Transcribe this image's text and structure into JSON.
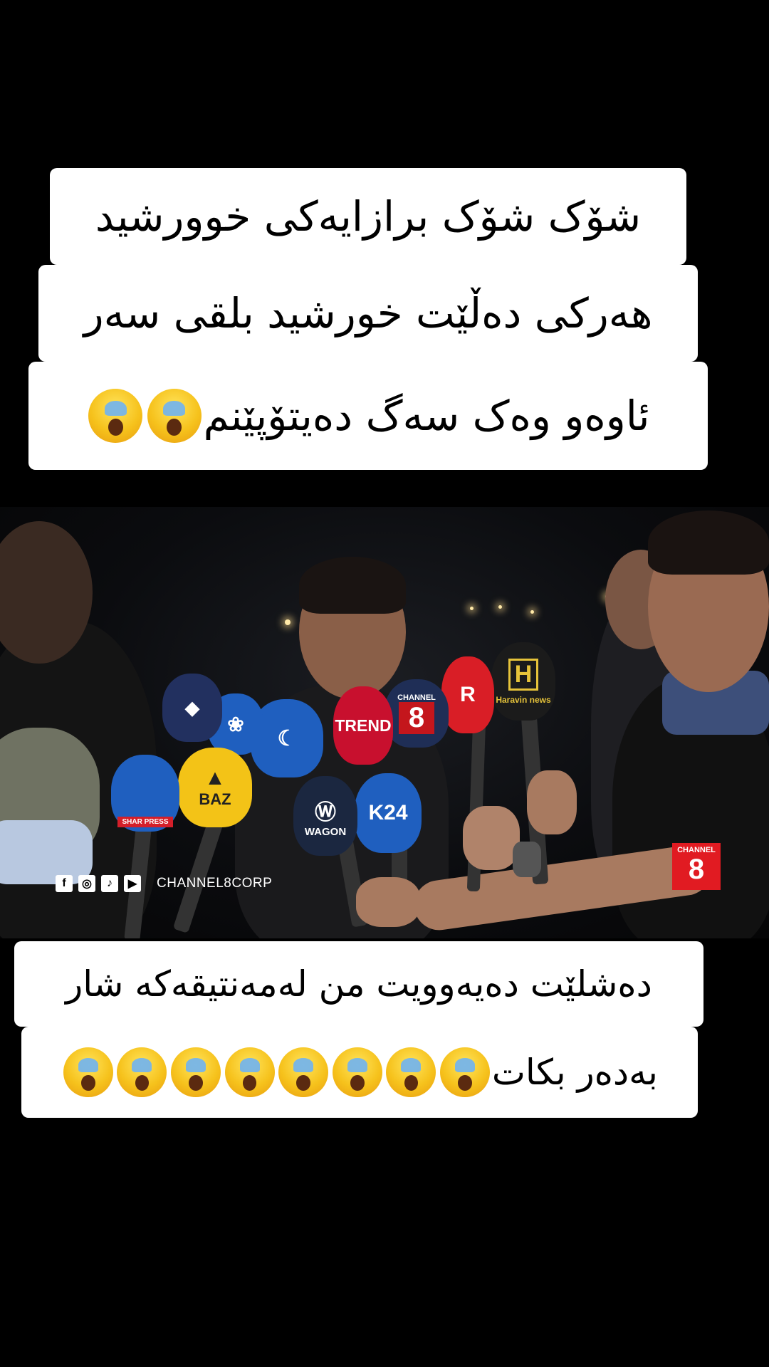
{
  "caption_top": {
    "lines": [
      "شۆک شۆک برازایەکی خوورشید",
      "هەرکی دەڵێت خورشید بلقی سەر",
      "ئاوەو وەک سەگ دەیتۆپێنم"
    ],
    "line3_emoji_count": 2,
    "emoji": "face-screaming-in-fear-icon"
  },
  "caption_bottom": {
    "lines": [
      "دەشلێت دەیەوویت من لەمەنتیقەکە شار",
      "بەدەر بکات"
    ],
    "line2_emoji_count": 8,
    "emoji": "face-screaming-in-fear-icon"
  },
  "video": {
    "watermark_handle": "CHANNEL8CORP",
    "social_icons": [
      "facebook-icon",
      "instagram-icon",
      "tiktok-icon",
      "youtube-icon"
    ],
    "corner_logo": {
      "top_text": "CHANNEL",
      "number": "8",
      "color": "#e11b22"
    },
    "microphones": [
      {
        "name": "channel-8",
        "top": "CHANNEL",
        "label": "8",
        "color": "#c4161c"
      },
      {
        "name": "trend",
        "label": "TREND",
        "color": "#c8102e"
      },
      {
        "name": "k24",
        "label": "K24",
        "color": "#1f5fbf"
      },
      {
        "name": "wagon",
        "label": "WAGON",
        "color": "#1b2740"
      },
      {
        "name": "baz",
        "label": "BAZ",
        "color": "#f3c317"
      },
      {
        "name": "shar-press",
        "label": "SHAR PRESS",
        "color": "#d41f2a"
      },
      {
        "name": "rudaw",
        "label": "R",
        "color": "#d91e26"
      },
      {
        "name": "haravin-news",
        "label": "Haravin news",
        "color": "#1b1b1b"
      }
    ]
  }
}
